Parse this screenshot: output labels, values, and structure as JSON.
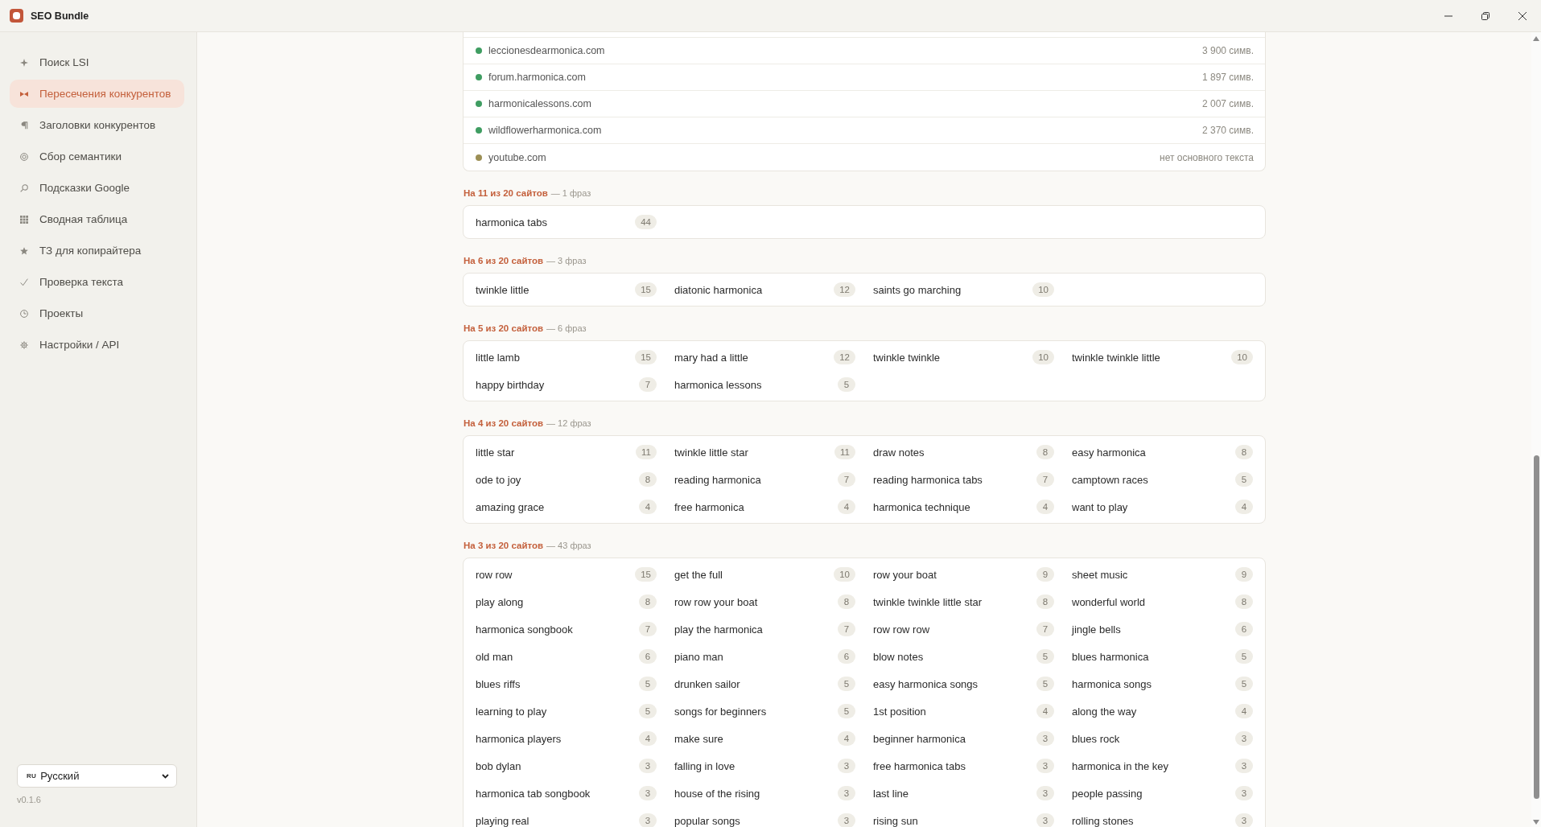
{
  "window": {
    "title": "SEO Bundle"
  },
  "sidebar": {
    "items": [
      {
        "label": "Поиск LSI",
        "selected": false
      },
      {
        "label": "Пересечения конкурентов",
        "selected": true
      },
      {
        "label": "Заголовки конкурентов",
        "selected": false
      },
      {
        "label": "Сбор семантики",
        "selected": false
      },
      {
        "label": "Подсказки Google",
        "selected": false
      },
      {
        "label": "Сводная таблица",
        "selected": false
      },
      {
        "label": "ТЗ для копирайтера",
        "selected": false
      },
      {
        "label": "Проверка текста",
        "selected": false
      },
      {
        "label": "Проекты",
        "selected": false
      },
      {
        "label": "Настройки / API",
        "selected": false
      }
    ],
    "language": {
      "flag": "RU",
      "label": "Русский"
    },
    "version": "v0.1.6"
  },
  "sites": [
    {
      "domain": "leccionesdearmonica.com",
      "info": "3 900 симв.",
      "color": "#3f9d62"
    },
    {
      "domain": "forum.harmonica.com",
      "info": "1 897 симв.",
      "color": "#3f9d62"
    },
    {
      "domain": "harmonicalessons.com",
      "info": "2 007 симв.",
      "color": "#3f9d62"
    },
    {
      "domain": "wildflowerharmonica.com",
      "info": "2 370 симв.",
      "color": "#3f9d62"
    },
    {
      "domain": "youtube.com",
      "info": "нет основного текста",
      "color": "#9c8f55"
    }
  ],
  "groups": [
    {
      "title": "На 11 из 20 сайтов",
      "count": "— 1 фраз",
      "phrases": [
        {
          "text": "harmonica tabs",
          "count": "44"
        }
      ]
    },
    {
      "title": "На 6 из 20 сайтов",
      "count": "— 3 фраз",
      "phrases": [
        {
          "text": "twinkle little",
          "count": "15"
        },
        {
          "text": "diatonic harmonica",
          "count": "12"
        },
        {
          "text": "saints go marching",
          "count": "10"
        }
      ]
    },
    {
      "title": "На 5 из 20 сайтов",
      "count": "— 6 фраз",
      "phrases": [
        {
          "text": "little lamb",
          "count": "15"
        },
        {
          "text": "mary had a little",
          "count": "12"
        },
        {
          "text": "twinkle twinkle",
          "count": "10"
        },
        {
          "text": "twinkle twinkle little",
          "count": "10"
        },
        {
          "text": "happy birthday",
          "count": "7"
        },
        {
          "text": "harmonica lessons",
          "count": "5"
        }
      ]
    },
    {
      "title": "На 4 из 20 сайтов",
      "count": "— 12 фраз",
      "phrases": [
        {
          "text": "little star",
          "count": "11"
        },
        {
          "text": "twinkle little star",
          "count": "11"
        },
        {
          "text": "draw notes",
          "count": "8"
        },
        {
          "text": "easy harmonica",
          "count": "8"
        },
        {
          "text": "ode to joy",
          "count": "8"
        },
        {
          "text": "reading harmonica",
          "count": "7"
        },
        {
          "text": "reading harmonica tabs",
          "count": "7"
        },
        {
          "text": "camptown races",
          "count": "5"
        },
        {
          "text": "amazing grace",
          "count": "4"
        },
        {
          "text": "free harmonica",
          "count": "4"
        },
        {
          "text": "harmonica technique",
          "count": "4"
        },
        {
          "text": "want to play",
          "count": "4"
        }
      ]
    },
    {
      "title": "На 3 из 20 сайтов",
      "count": "— 43 фраз",
      "phrases": [
        {
          "text": "row row",
          "count": "15"
        },
        {
          "text": "get the full",
          "count": "10"
        },
        {
          "text": "row your boat",
          "count": "9"
        },
        {
          "text": "sheet music",
          "count": "9"
        },
        {
          "text": "play along",
          "count": "8"
        },
        {
          "text": "row row your boat",
          "count": "8"
        },
        {
          "text": "twinkle twinkle little star",
          "count": "8"
        },
        {
          "text": "wonderful world",
          "count": "8"
        },
        {
          "text": "harmonica songbook",
          "count": "7"
        },
        {
          "text": "play the harmonica",
          "count": "7"
        },
        {
          "text": "row row row",
          "count": "7"
        },
        {
          "text": "jingle bells",
          "count": "6"
        },
        {
          "text": "old man",
          "count": "6"
        },
        {
          "text": "piano man",
          "count": "6"
        },
        {
          "text": "blow notes",
          "count": "5"
        },
        {
          "text": "blues harmonica",
          "count": "5"
        },
        {
          "text": "blues riffs",
          "count": "5"
        },
        {
          "text": "drunken sailor",
          "count": "5"
        },
        {
          "text": "easy harmonica songs",
          "count": "5"
        },
        {
          "text": "harmonica songs",
          "count": "5"
        },
        {
          "text": "learning to play",
          "count": "5"
        },
        {
          "text": "songs for beginners",
          "count": "5"
        },
        {
          "text": "1st position",
          "count": "4"
        },
        {
          "text": "along the way",
          "count": "4"
        },
        {
          "text": "harmonica players",
          "count": "4"
        },
        {
          "text": "make sure",
          "count": "4"
        },
        {
          "text": "beginner harmonica",
          "count": "3"
        },
        {
          "text": "blues rock",
          "count": "3"
        },
        {
          "text": "bob dylan",
          "count": "3"
        },
        {
          "text": "falling in love",
          "count": "3"
        },
        {
          "text": "free harmonica tabs",
          "count": "3"
        },
        {
          "text": "harmonica in the key",
          "count": "3"
        },
        {
          "text": "harmonica tab songbook",
          "count": "3"
        },
        {
          "text": "house of the rising",
          "count": "3"
        },
        {
          "text": "last line",
          "count": "3"
        },
        {
          "text": "people passing",
          "count": "3"
        },
        {
          "text": "playing real",
          "count": "3"
        },
        {
          "text": "popular songs",
          "count": "3"
        },
        {
          "text": "rising sun",
          "count": "3"
        },
        {
          "text": "rolling stones",
          "count": "3"
        }
      ]
    }
  ]
}
